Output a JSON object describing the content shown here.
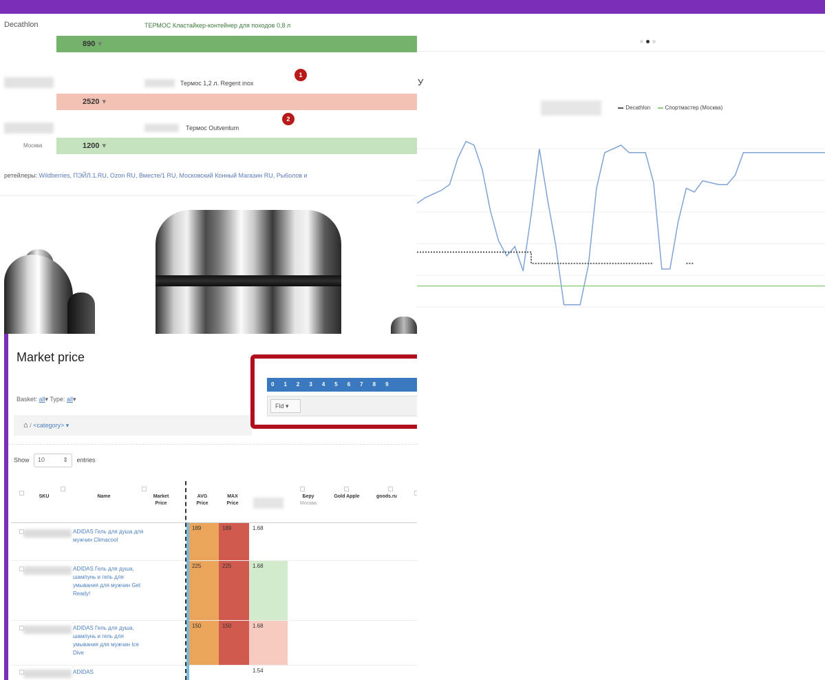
{
  "offers": {
    "store1": "Decathlon",
    "title1": "ТЕРМОС Кластайкер-контейнер для походов 0,8 л",
    "price1": "890",
    "title2": "Термос 1,2 л. Regent inox",
    "price2": "2520",
    "badge1": "1",
    "title3": "Термос Outventum",
    "price3": "1200",
    "badge2": "2",
    "region": "Москва",
    "caret": "▾",
    "retailers_label": "ретейлеры:",
    "retailers": "Wildberries, ПЭЙЛ.1.RU, Ozon RU, Вместе/1 RU, Московский Конный Магазин RU, Ры6олов и",
    "colors": {
      "green": "#75b26b",
      "pink": "#f4c2b4",
      "lightgreen": "#c4e3bd",
      "badge": "#b81a1a"
    }
  },
  "chart": {
    "side_letter": "У",
    "legend": [
      {
        "name": "Decathlon",
        "color": "#555555"
      },
      {
        "name": "Спортмастер (Москва)",
        "color": "#8fd07e"
      }
    ],
    "colors": {
      "primary": "#7fa3d6",
      "secondary": "#555555",
      "tertiary": "#8fd07e"
    }
  },
  "chart_data": {
    "type": "line",
    "x": [
      0,
      2,
      4,
      6,
      8,
      10,
      12,
      14,
      16,
      18,
      20,
      22,
      24,
      26,
      28,
      30,
      32,
      34,
      36,
      38,
      40,
      42,
      44,
      46,
      48,
      50,
      52,
      54,
      56,
      58,
      60,
      62,
      64,
      66,
      68,
      70,
      72,
      74,
      76,
      78,
      80,
      82,
      84,
      86,
      88,
      90,
      92,
      94,
      96,
      98,
      100
    ],
    "series": [
      {
        "name": "",
        "values": [
          64,
          67,
          69,
          71,
          74,
          88,
          97,
          95,
          82,
          60,
          44,
          36,
          41,
          28,
          58,
          93,
          66,
          42,
          10,
          10,
          10,
          31,
          72,
          91,
          93,
          95,
          91,
          91,
          91,
          75,
          29,
          29,
          54,
          72,
          70,
          76,
          75,
          74,
          74,
          79,
          91,
          91,
          91,
          91,
          91,
          91,
          91,
          91,
          91,
          91,
          91
        ]
      },
      {
        "name": "Decathlon",
        "values": [
          38,
          38,
          38,
          38,
          38,
          38,
          38,
          38,
          38,
          38,
          38,
          38,
          38,
          38,
          32,
          32,
          32,
          32,
          32,
          32,
          32,
          32,
          32,
          32,
          32,
          32,
          32,
          32,
          32,
          32,
          null,
          null,
          null,
          32,
          32,
          null,
          null,
          null,
          null,
          null,
          null,
          null,
          null,
          null,
          null,
          null,
          null,
          null,
          null,
          null,
          null
        ]
      },
      {
        "name": "Спортмастер (Москва)",
        "values": [
          20,
          20,
          20,
          20,
          20,
          20,
          20,
          20,
          20,
          20,
          20,
          20,
          20,
          20,
          20,
          20,
          20,
          20,
          20,
          20,
          20,
          20,
          20,
          20,
          20,
          20,
          20,
          20,
          20,
          20,
          20,
          20,
          20,
          20,
          20,
          20,
          20,
          20,
          20,
          20,
          20,
          20,
          20,
          20,
          20,
          20,
          20,
          20,
          20,
          20,
          20
        ]
      }
    ],
    "ylim": [
      0,
      110
    ],
    "grid": true
  },
  "market": {
    "title": "Market price",
    "basket_label": "Basket:",
    "basket_value": "all",
    "type_label": "Type:",
    "type_value": "all",
    "filter_arrow": "▾",
    "home": "⌂",
    "crumb_sep": "/",
    "category": "<category>",
    "category_arrow": "▾",
    "tabs": [
      "0",
      "1",
      "2",
      "3",
      "4",
      "5",
      "6",
      "7",
      "8",
      "9"
    ],
    "filter_button": "Fld",
    "show_label": "Show",
    "show_value": "10",
    "show_arrow": "⇕",
    "entries_label": "entries",
    "headers": {
      "sku": "SKU",
      "name": "Name",
      "market": "Market\nPrice",
      "avg": "AVG\nPrice",
      "max": "MAX\nPrice",
      "beru": "Беру",
      "beru_sub": "Москва",
      "gold": "Gold Apple",
      "goods": "goods.ru"
    },
    "rows": [
      {
        "name": "ADIDAS Гель для душа для мужчин Climacool",
        "avg": "189",
        "max": "189",
        "shop": "1.68"
      },
      {
        "name": "ADIDAS Гель для душа, шампунь и гель для умывания для мужчин Get Ready!",
        "avg": "225",
        "max": "225",
        "shop": "1.68"
      },
      {
        "name": "ADIDAS Гель для душа, шампунь и гель для умывания для мужчин Ice Dive",
        "avg": "150",
        "max": "150",
        "shop": "1.68"
      },
      {
        "name": "ADIDAS",
        "avg": "",
        "max": "",
        "shop": "1.54"
      }
    ]
  }
}
